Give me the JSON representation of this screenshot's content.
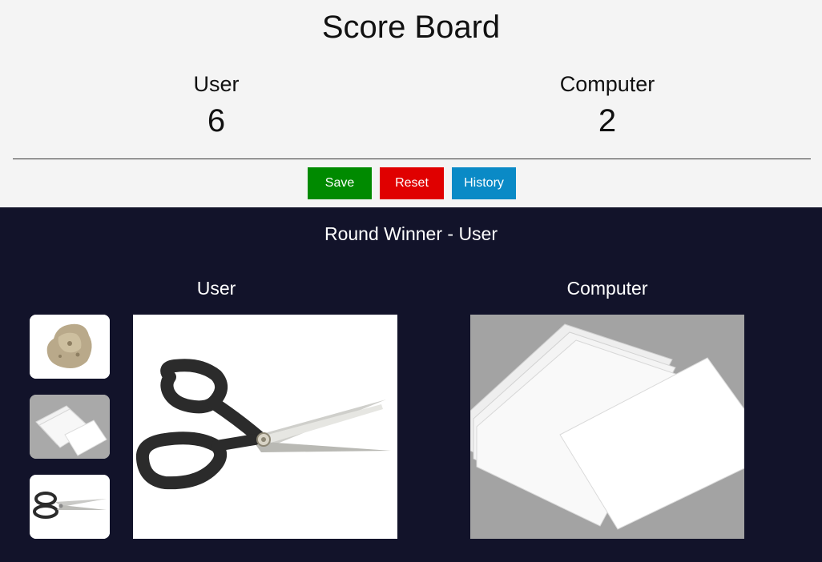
{
  "scoreboard": {
    "title": "Score Board",
    "user_label": "User",
    "user_score": "6",
    "computer_label": "Computer",
    "computer_score": "2"
  },
  "buttons": {
    "save": "Save",
    "reset": "Reset",
    "history": "History"
  },
  "colors": {
    "save": "#008a00",
    "reset": "#e00000",
    "history": "#0a8ac6",
    "game_bg": "#12132a"
  },
  "game": {
    "round_winner": "Round Winner - User",
    "user_label": "User",
    "computer_label": "Computer",
    "choices": [
      {
        "name": "rock",
        "icon": "rock-image"
      },
      {
        "name": "paper",
        "icon": "paper-image"
      },
      {
        "name": "scissors",
        "icon": "scissors-image"
      }
    ],
    "user_choice": "scissors",
    "computer_choice": "paper"
  }
}
